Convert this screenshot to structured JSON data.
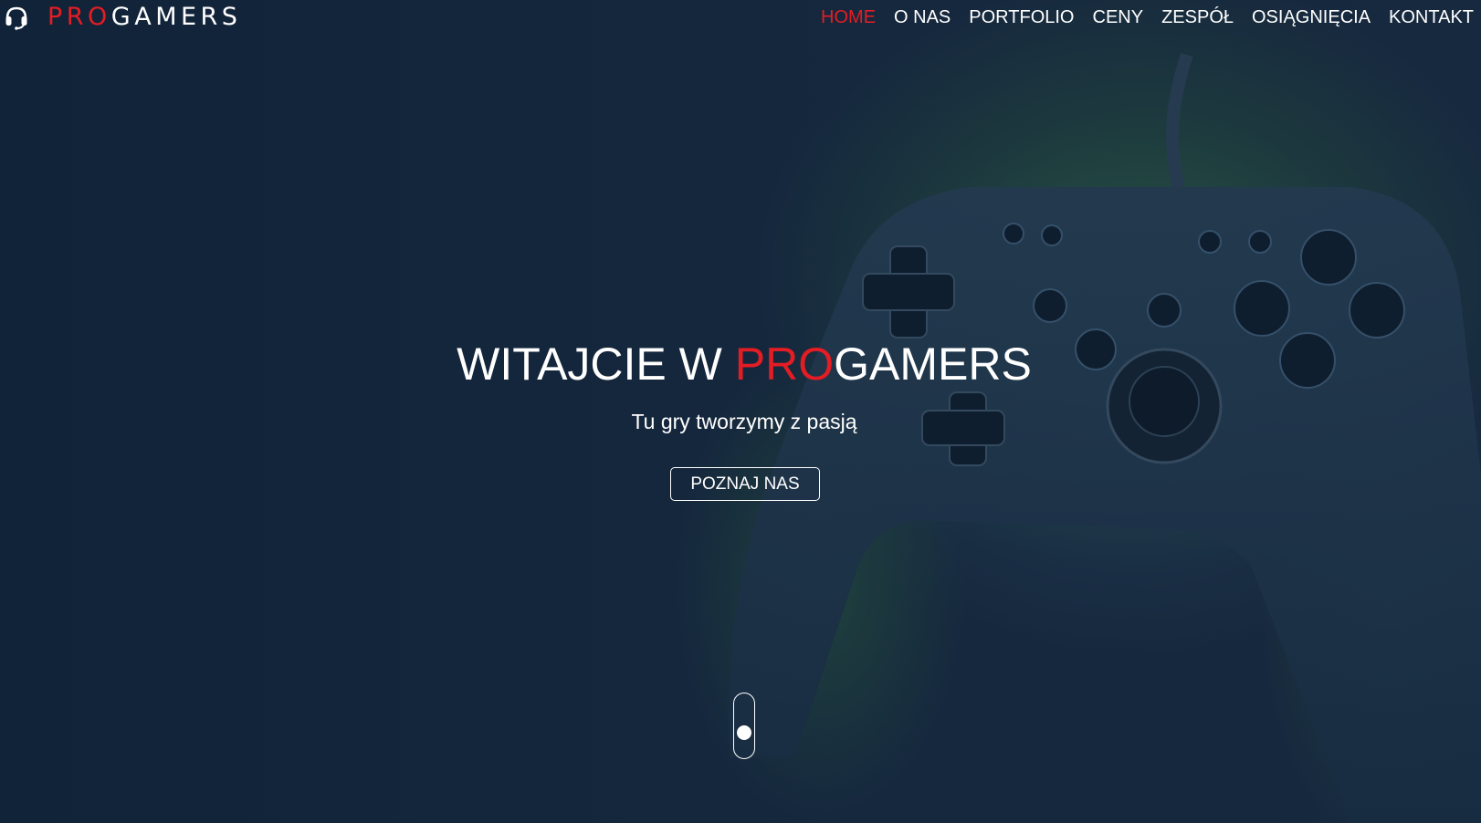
{
  "brand": {
    "name_accent": "PRO",
    "name_rest": "GAMERS",
    "icon": "headset-icon",
    "accent_color": "#e41d24"
  },
  "nav": {
    "items": [
      {
        "label": "HOME",
        "active": true
      },
      {
        "label": "O NAS",
        "active": false
      },
      {
        "label": "PORTFOLIO",
        "active": false
      },
      {
        "label": "CENY",
        "active": false
      },
      {
        "label": "ZESPÓŁ",
        "active": false
      },
      {
        "label": "OSIĄGNIĘCIA",
        "active": false
      },
      {
        "label": "KONTAKT",
        "active": false
      }
    ]
  },
  "hero": {
    "title_prefix": "WITAJCIE W ",
    "title_accent": "PRO",
    "title_rest": "GAMERS",
    "subtitle": "Tu gry tworzymy z pasją",
    "cta_label": "POZNAJ NAS",
    "background_image": "game-controller-smoke",
    "scroll_indicator": "scroll-mouse-icon"
  }
}
